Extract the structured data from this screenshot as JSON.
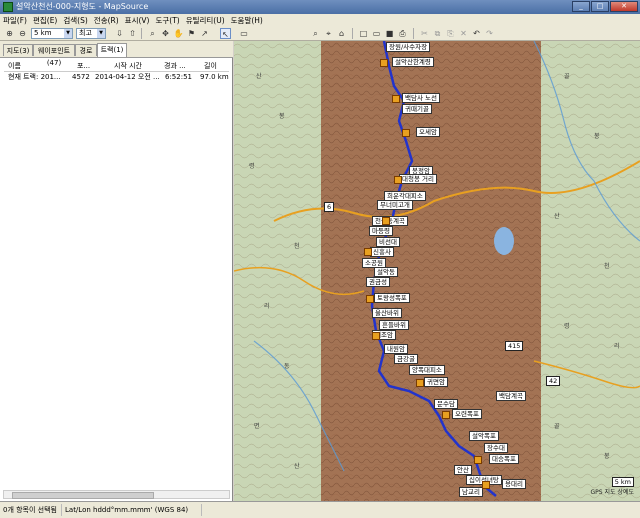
{
  "window": {
    "title": "설악산천선-000-지형도 - MapSource",
    "min": "_",
    "max": "□",
    "close": "✕"
  },
  "menu": [
    "파일(F)",
    "편집(E)",
    "검색(S)",
    "전송(R)",
    "표시(V)",
    "도구(T)",
    "유틸리티(U)",
    "도움말(H)"
  ],
  "toolbar": {
    "scale_value": "5 km",
    "detail_value": "최고"
  },
  "tabs": [
    "지도(3)",
    "웨이포인트(47)",
    "경로",
    "트랙(1)"
  ],
  "track_table": {
    "headers": [
      "이름",
      "포...",
      "시작 시간",
      "경과 ...",
      "길이"
    ],
    "rows": [
      [
        "현재 트랙: 201...",
        "4572",
        "2014-04-12 오전 ...",
        "6:52:51",
        "97.0 km"
      ]
    ]
  },
  "status": {
    "selection": "0개 항목이 선택됨",
    "coords": "Lat/Lon hddd°mm.mmm' (WGS 84)"
  },
  "map": {
    "labels": [
      "장원/사수자장",
      "설악산한계령",
      "백담사 노선",
      "귀때기골",
      "오세암",
      "봉정암",
      "대청봉 거리",
      "희운각대피소",
      "무너미고개",
      "천불동계곡",
      "마등령",
      "비선대",
      "신흥사",
      "소공원",
      "설악동",
      "권금성",
      "토왕성폭포",
      "울산바위",
      "흔들바위",
      "계조암",
      "내원암",
      "금강굴",
      "양폭대피소",
      "귀면암",
      "문수담",
      "오련폭포",
      "설악폭포",
      "장수대",
      "대승폭포",
      "안산",
      "십이선녀탕",
      "남교리",
      "용대리",
      "백담계곡"
    ],
    "road_shields": [
      "6",
      "42",
      "415",
      "5 km"
    ],
    "places": [
      "산",
      "봉",
      "령",
      "천",
      "리",
      "동",
      "면",
      "산",
      "골",
      "봉",
      "산",
      "천",
      "령",
      "리",
      "골",
      "봉"
    ],
    "scale_text": "GPS 지도 상예도",
    "colors": {
      "terrain": "#c9d6b5",
      "shaded_area": "#9a5a3c",
      "track": "#2233cc",
      "road": "#e8a020"
    }
  }
}
